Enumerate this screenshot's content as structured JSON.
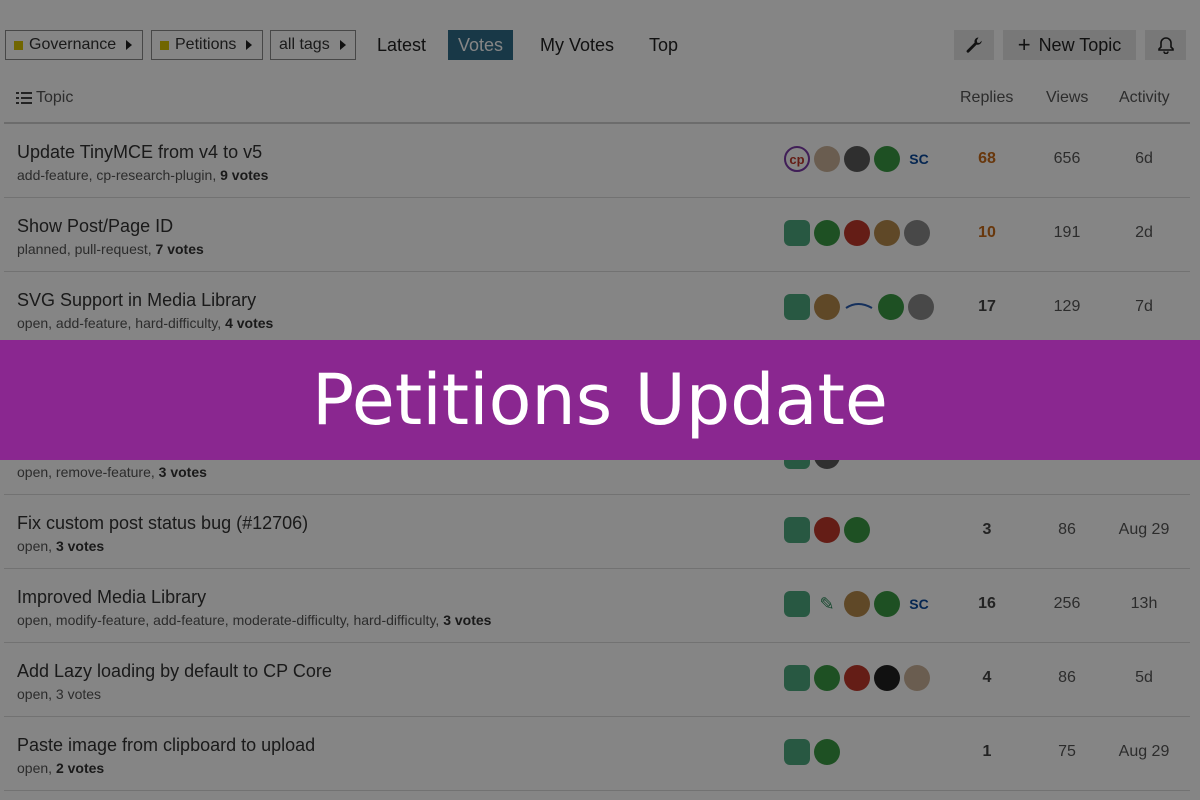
{
  "nav": {
    "crumbs": [
      {
        "label": "Governance",
        "has_square": true
      },
      {
        "label": "Petitions",
        "has_square": true
      },
      {
        "label": "all tags",
        "has_square": false
      }
    ],
    "links": [
      "Latest",
      "Votes",
      "My Votes",
      "Top"
    ],
    "active_link": "Votes",
    "new_topic_label": "New Topic",
    "icons": {
      "admin": "wrench-icon",
      "new_topic": "plus-icon",
      "notifications": "bell-icon",
      "crumb_caret": "caret-right-icon"
    }
  },
  "table": {
    "headers": {
      "topic": "Topic",
      "replies": "Replies",
      "views": "Views",
      "activity": "Activity"
    },
    "topic_header_icon": "list-icon",
    "rows": [
      {
        "title": "Update TinyMCE from v4 to v5",
        "tags": "add-feature, cp-research-plugin, ",
        "votes": "9 votes",
        "replies": "68",
        "views": "656",
        "activity": "6d",
        "hot": true,
        "avatars": [
          "cp-logo",
          "tan",
          "darkgray",
          "green",
          "sc-logo"
        ]
      },
      {
        "title": "Show Post/Page ID",
        "tags": "planned, pull-request, ",
        "votes": "7 votes",
        "replies": "10",
        "views": "191",
        "activity": "2d",
        "hot": true,
        "avatars": [
          "teal",
          "green",
          "red",
          "brown",
          "gray"
        ]
      },
      {
        "title": "SVG Support in Media Library",
        "tags": "open, add-feature, hard-difficulty, ",
        "votes": "4 votes",
        "replies": "17",
        "views": "129",
        "activity": "7d",
        "hot": false,
        "avatars": [
          "teal",
          "brown",
          "swoosh",
          "green",
          "gray"
        ]
      },
      {
        "title": "",
        "tags": "open, remove-feature, ",
        "votes": "3 votes",
        "replies": "",
        "views": "",
        "activity": "",
        "hot": false,
        "avatars": [
          "teal",
          "darkgray"
        ]
      },
      {
        "title": "Fix custom post status bug (#12706)",
        "tags": "open, ",
        "votes": "3 votes",
        "replies": "3",
        "views": "86",
        "activity": "Aug 29",
        "hot": false,
        "avatars": [
          "teal",
          "red",
          "green"
        ]
      },
      {
        "title": "Improved Media Library",
        "tags": "open, modify-feature, add-feature, moderate-difficulty, hard-difficulty, ",
        "votes": "3 votes",
        "replies": "16",
        "views": "256",
        "activity": "13h",
        "hot": false,
        "avatars": [
          "teal",
          "feather",
          "brown",
          "green",
          "sc-logo"
        ]
      },
      {
        "title": "Add Lazy loading by default to CP Core",
        "tags": "open, 3 votes",
        "votes": "",
        "replies": "4",
        "views": "86",
        "activity": "5d",
        "hot": false,
        "avatars": [
          "teal",
          "green",
          "red",
          "black",
          "tan"
        ]
      },
      {
        "title": "Paste image from clipboard to upload",
        "tags": "open, ",
        "votes": "2 votes",
        "replies": "1",
        "views": "75",
        "activity": "Aug 29",
        "hot": false,
        "avatars": [
          "teal",
          "green"
        ]
      }
    ]
  },
  "banner": {
    "text": "Petitions Update",
    "color": "#8a2790"
  }
}
